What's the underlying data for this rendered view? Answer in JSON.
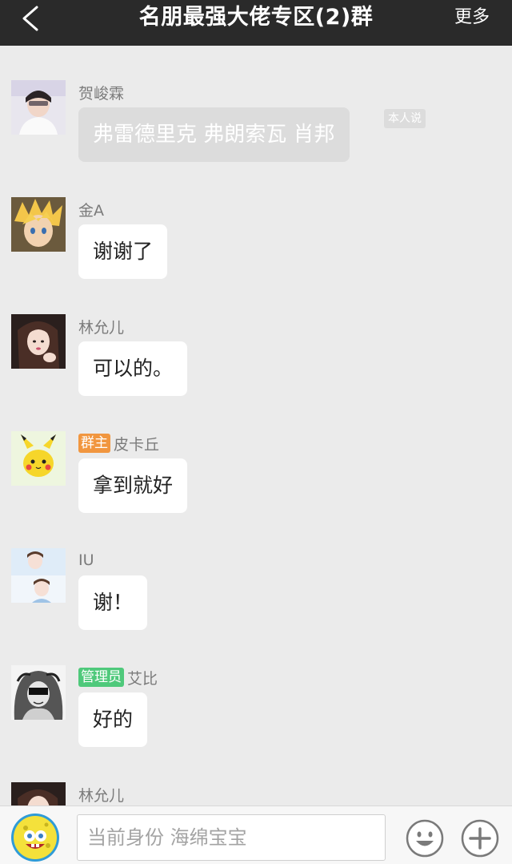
{
  "header": {
    "title": "名朋最强大佬专区(2)群",
    "more_label": "更多"
  },
  "messages": [
    {
      "sender": "贺峻霖",
      "text": "弗雷德里克 弗朗索瓦 肖邦",
      "tag": "本人说",
      "badge": ""
    },
    {
      "sender": "金A",
      "text": "谢谢了",
      "badge": ""
    },
    {
      "sender": "林允儿",
      "text": "可以的。",
      "badge": ""
    },
    {
      "sender": "皮卡丘",
      "text": "拿到就好",
      "badge": "群主"
    },
    {
      "sender": "IU",
      "text": "谢！",
      "badge": ""
    },
    {
      "sender": "艾比",
      "text": "好的",
      "badge": "管理员"
    },
    {
      "sender": "林允儿",
      "text": "",
      "badge": ""
    }
  ],
  "input": {
    "placeholder": "当前身份 海绵宝宝"
  },
  "icons": {
    "back": "chevron-left-icon",
    "emoji": "smiley-icon",
    "plus": "plus-icon"
  },
  "colors": {
    "header_bg": "#2a2a2a",
    "owner_badge": "#f1963f",
    "admin_badge": "#4fc97b"
  }
}
